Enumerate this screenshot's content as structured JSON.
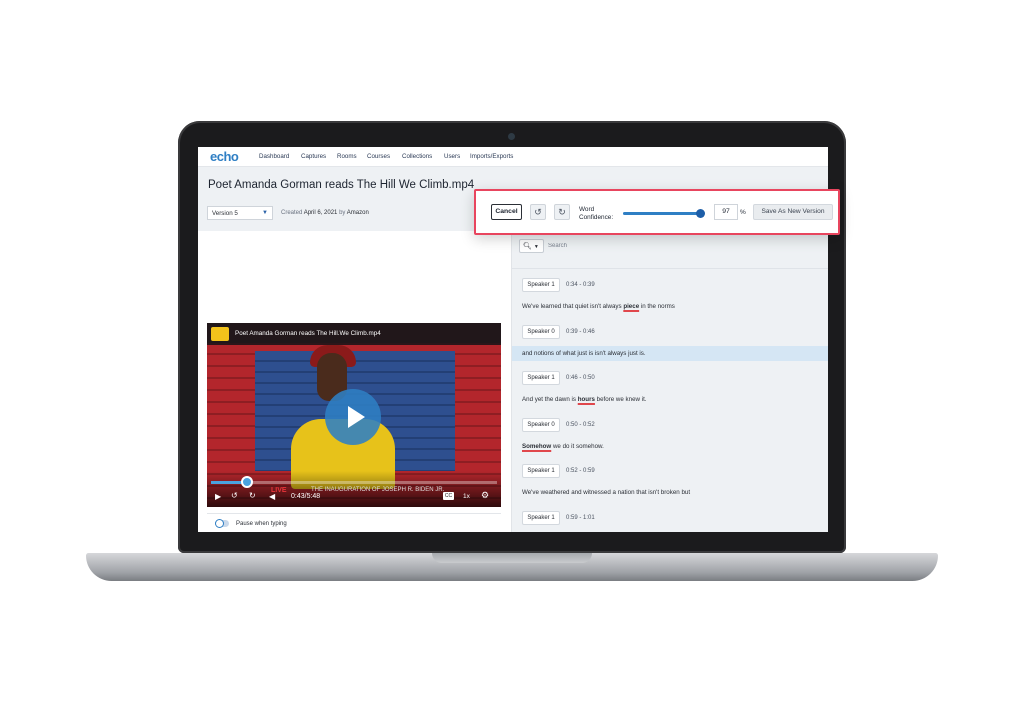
{
  "app": {
    "logo": "echo",
    "nav": [
      "Dashboard",
      "Captures",
      "Rooms",
      "Courses",
      "Collections",
      "Users",
      "Imports/Exports"
    ]
  },
  "media": {
    "title": "Poet Amanda Gorman reads The Hill We Climb.mp4",
    "version": "Version 5",
    "created_prefix": "Created",
    "created_date": "April 6, 2021",
    "created_by_prefix": "by",
    "created_by": "Amazon"
  },
  "toolbar": {
    "cancel_label": "Cancel",
    "undo_icon": "undo-icon",
    "redo_icon": "redo-icon",
    "word_confidence_label": "Word Confidence:",
    "confidence_value": "97",
    "confidence_fraction": 0.97,
    "percent_symbol": "%",
    "save_label": "Save As New Version"
  },
  "player": {
    "title": "Poet Amanda Gorman reads The Hill.We Climb.mp4",
    "time": "0:43/5:48",
    "progress_fraction": 0.125,
    "live_label": "LIVE",
    "chyron": "THE INAUGURATION OF JOSEPH R. BIDEN JR.",
    "cc_label": "CC",
    "speed": "1x",
    "pause_when_typing_label": "Pause when typing"
  },
  "search": {
    "placeholder": "Search",
    "icon": "search-icon"
  },
  "transcript": [
    {
      "speaker": "Speaker 1",
      "time": "0:34 - 0:39",
      "before": "We've learned that quiet isn't always ",
      "flag": "piece",
      "after": " in the norms",
      "highlight": false
    },
    {
      "speaker": "Speaker 0",
      "time": "0:39 - 0:46",
      "before": "and notions of what just is isn't always just is.",
      "flag": "",
      "after": "",
      "highlight": true
    },
    {
      "speaker": "Speaker 1",
      "time": "0:46 - 0:50",
      "before": "And yet the dawn is ",
      "flag": "hours",
      "after": " before we knew it.",
      "highlight": false
    },
    {
      "speaker": "Speaker 0",
      "time": "0:50 - 0:52",
      "before": "",
      "flag": "Somehow",
      "after": " we do it somehow.",
      "highlight": false
    },
    {
      "speaker": "Speaker 1",
      "time": "0:52 - 0:59",
      "before": "We've weathered and witnessed a nation that isn't broken but",
      "flag": "",
      "after": "",
      "highlight": false
    },
    {
      "speaker": "Speaker 1",
      "time": "0:59 - 1:01",
      "before": "",
      "flag": "",
      "after": "",
      "highlight": false
    }
  ],
  "colors": {
    "accent": "#2f7fc4",
    "focus_outline": "#e8455e",
    "low_confidence_underline": "#e0474c",
    "highlight_row": "#d5e6f4"
  }
}
